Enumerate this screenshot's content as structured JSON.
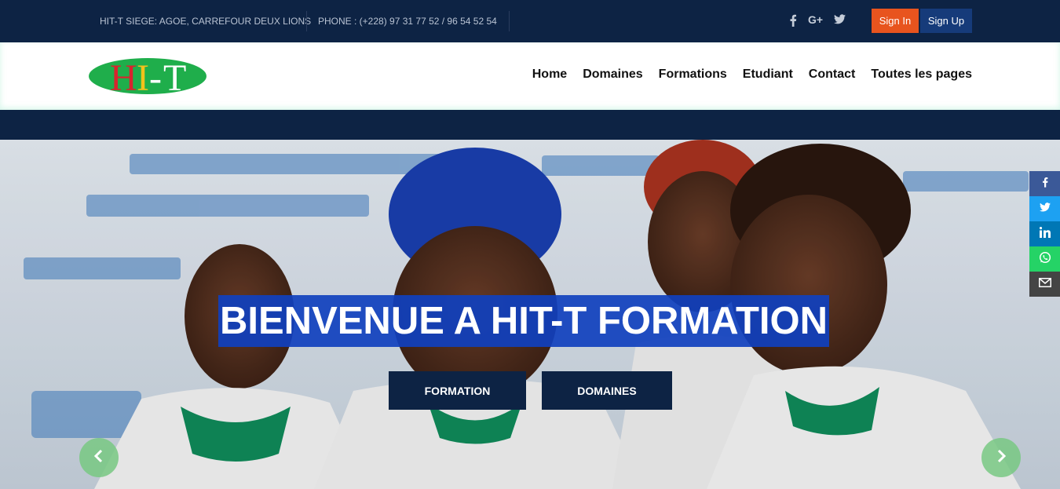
{
  "topbar": {
    "address": "HIT-T SIEGE: AGOE, CARREFOUR DEUX LIONS",
    "phone": "PHONE : (+228) 97 31 77 52 / 96 54 52 54",
    "social": [
      "facebook-icon",
      "google-plus-icon",
      "twitter-icon"
    ],
    "signin_label": "Sign In",
    "signup_label": "Sign Up",
    "colors": {
      "bar": "#0d2344",
      "signin": "#e8541e",
      "signup": "#163b7a"
    }
  },
  "logo": {
    "text": "HIT-T",
    "colors": {
      "oval": "#1fae4b",
      "H": "#d9232e",
      "I": "#f2c21b",
      "T": "#d9232e"
    }
  },
  "nav": {
    "items": [
      "Home",
      "Domaines",
      "Formations",
      "Etudiant",
      "Contact",
      "Toutes les pages"
    ]
  },
  "hero": {
    "title": "BIENVENUE A HIT-T FORMATION",
    "buttons": [
      "FORMATION",
      "DOMAINES"
    ],
    "arrows": [
      "chevron-left-icon",
      "chevron-right-icon"
    ]
  },
  "share_sidebar": [
    {
      "icon": "facebook-icon",
      "color": "#3b5998"
    },
    {
      "icon": "twitter-icon",
      "color": "#1da1f2"
    },
    {
      "icon": "linkedin-icon",
      "color": "#0077b5"
    },
    {
      "icon": "whatsapp-icon",
      "color": "#25d366"
    },
    {
      "icon": "email-icon",
      "color": "#444444"
    }
  ]
}
